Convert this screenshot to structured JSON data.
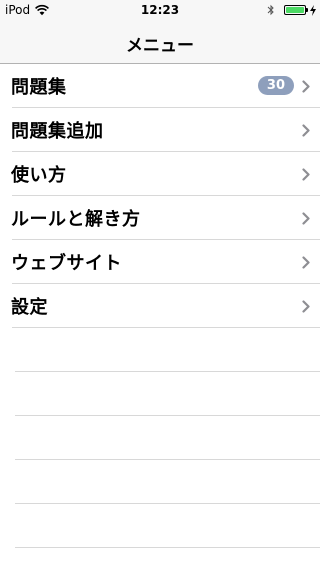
{
  "status_bar": {
    "carrier": "iPod",
    "time": "12:23",
    "icons": [
      "wifi-icon",
      "bluetooth-icon",
      "battery-icon",
      "charging-icon"
    ],
    "battery_color": "#4cd964"
  },
  "nav": {
    "title": "メニュー"
  },
  "menu": {
    "items": [
      {
        "label": "問題集",
        "badge": "30"
      },
      {
        "label": "問題集追加"
      },
      {
        "label": "使い方"
      },
      {
        "label": "ルールと解き方"
      },
      {
        "label": "ウェブサイト"
      },
      {
        "label": "設定"
      }
    ]
  },
  "colors": {
    "badge": "#8e9fbc",
    "separator": "#d8d8d8",
    "chevron": "#8e8e93"
  }
}
